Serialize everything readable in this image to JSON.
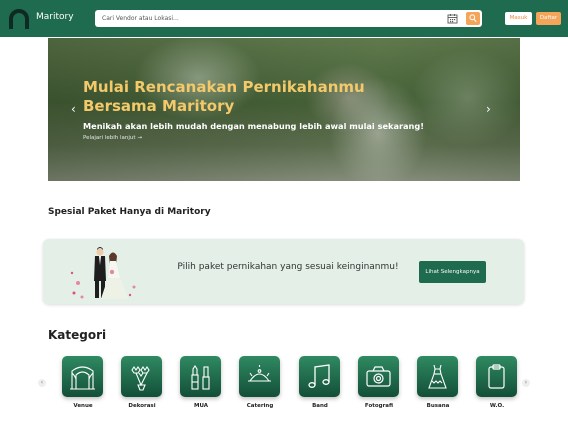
{
  "header": {
    "brand": "Maritory",
    "search_placeholder": "Cari Vendor atau Lokasi...",
    "login_label": "Masuk",
    "register_label": "Daftar",
    "icons": [
      "logo-icon",
      "calendar-icon",
      "search-icon"
    ]
  },
  "hero": {
    "title": "Mulai Rencanakan Pernikahanmu Bersama Maritory",
    "subtitle": "Menikah akan lebih mudah dengan menabung lebih awal mulai sekarang!",
    "link_label": "Pelajari lebih lanjut",
    "prev_icon": "chevron-left-icon",
    "next_icon": "chevron-right-icon"
  },
  "special": {
    "title": "Spesial Paket Hanya di Maritory",
    "promo_text": "Pilih paket pernikahan yang sesuai keinginanmu!",
    "cta_label": "Lihat Selengkapnya"
  },
  "kategori": {
    "title": "Kategori",
    "items": [
      {
        "label": "Venue",
        "icon": "venue-icon"
      },
      {
        "label": "Dekorasi",
        "icon": "flowers-icon"
      },
      {
        "label": "MUA",
        "icon": "makeup-icon"
      },
      {
        "label": "Catering",
        "icon": "food-cloche-icon"
      },
      {
        "label": "Band",
        "icon": "music-note-icon"
      },
      {
        "label": "Fotografi",
        "icon": "camera-icon"
      },
      {
        "label": "Busana",
        "icon": "dress-icon"
      },
      {
        "label": "W.O.",
        "icon": "clipboard-icon"
      }
    ]
  },
  "colors": {
    "primary": "#1f6b4f",
    "accent": "#f4a55a",
    "hero_title": "#f3c96a",
    "promo_bg": "#e3efe7"
  }
}
